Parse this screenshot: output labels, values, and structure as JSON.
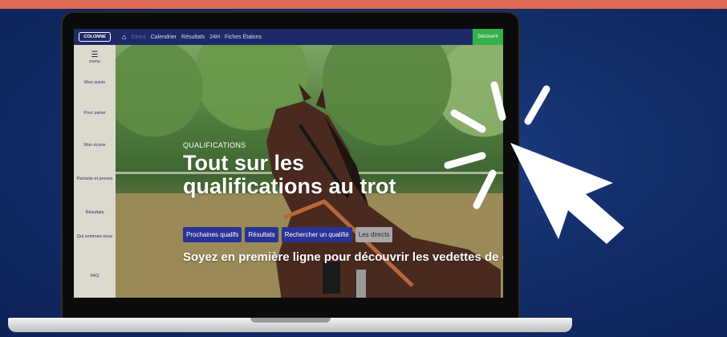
{
  "nav": {
    "logo_text": "COLONNE",
    "links": [
      "Direct",
      "Calendrier",
      "Résultats",
      "24H",
      "Fiches Étalons"
    ],
    "cta": "Découvrir"
  },
  "sidebar": {
    "menu_label": "menu",
    "items": [
      {
        "label": "Mon suivis"
      },
      {
        "label": "Pour parier"
      },
      {
        "label": "Mon écurie"
      },
      {
        "label": "Partants et pronos"
      },
      {
        "label": "Résultats"
      },
      {
        "label": "Qui sommes-nous"
      },
      {
        "label": "FAQ"
      }
    ]
  },
  "hero": {
    "eyebrow": "QUALIFICATIONS",
    "headline_line1": "Tout sur les",
    "headline_line2": "qualifications au trot",
    "buttons": [
      "Prochaines qualifs",
      "Résultats",
      "Rechercher un qualifié",
      "Les directs"
    ],
    "subline": "Soyez en première ligne pour découvrir les vedettes de demai"
  },
  "colors": {
    "background": "#132f6c",
    "top_stripe": "#de6b55",
    "navbar": "#1e2a68",
    "cta": "#33b14a",
    "button": "#2b3295"
  },
  "icons": [
    "home-icon",
    "hamburger-icon",
    "cursor-click-icon"
  ]
}
